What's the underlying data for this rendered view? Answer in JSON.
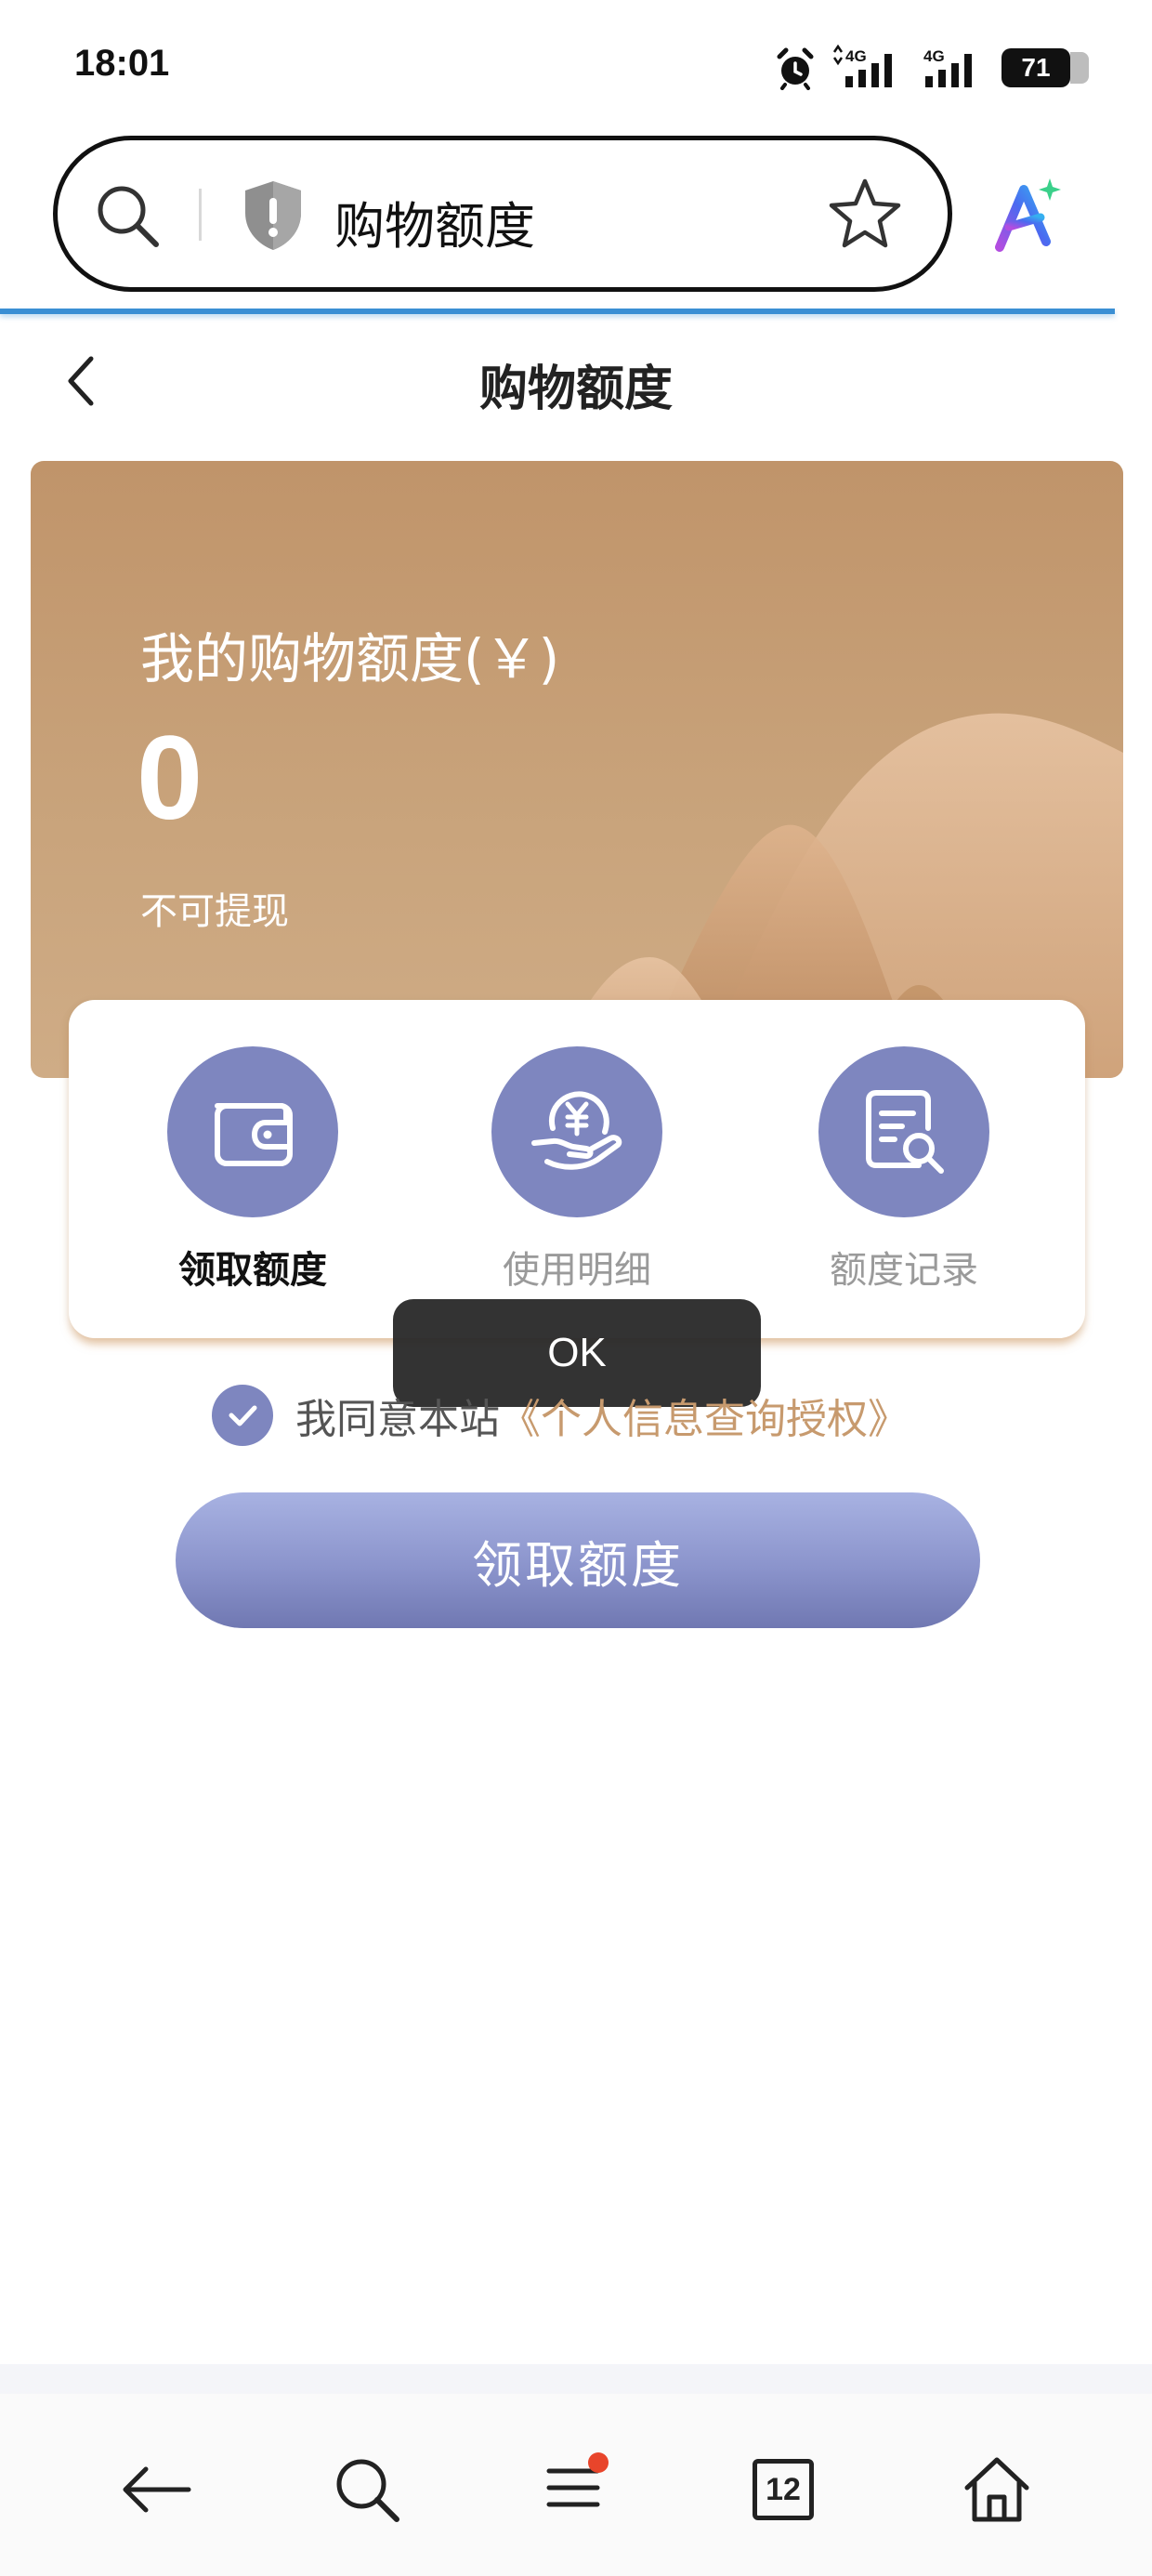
{
  "status_bar": {
    "time": "18:01",
    "network_1": "4G",
    "network_2": "4G",
    "battery": "71",
    "icons": [
      "alarm-icon",
      "signal-icon",
      "signal-icon",
      "battery-icon"
    ]
  },
  "browser": {
    "address_text": "购物额度",
    "icons": [
      "search-icon",
      "shield-warning-icon",
      "star-icon",
      "ai-assistant-icon"
    ]
  },
  "page": {
    "title": "购物额度"
  },
  "banner": {
    "label": "我的购物额度(￥)",
    "value": "0",
    "note": "不可提现"
  },
  "actions": [
    {
      "label": "领取额度",
      "icon": "wallet-icon",
      "active": true
    },
    {
      "label": "使用明细",
      "icon": "yuan-hand-icon",
      "active": false
    },
    {
      "label": "额度记录",
      "icon": "document-search-icon",
      "active": false
    }
  ],
  "toast": {
    "text": "OK"
  },
  "agreement": {
    "text": "我同意本站",
    "link": "《个人信息查询授权》",
    "checked": true
  },
  "claim_button": {
    "label": "领取额度"
  },
  "bottom_nav": {
    "tab_count": "12",
    "items": [
      "back-arrow-icon",
      "search-icon",
      "menu-icon",
      "tabs-icon",
      "home-icon"
    ]
  },
  "colors": {
    "accent": "#7e86bf",
    "banner": "#c0946a",
    "link": "#c79a6e",
    "url_bar_line": "#3a8fd4",
    "notification_dot": "#e8452b"
  }
}
